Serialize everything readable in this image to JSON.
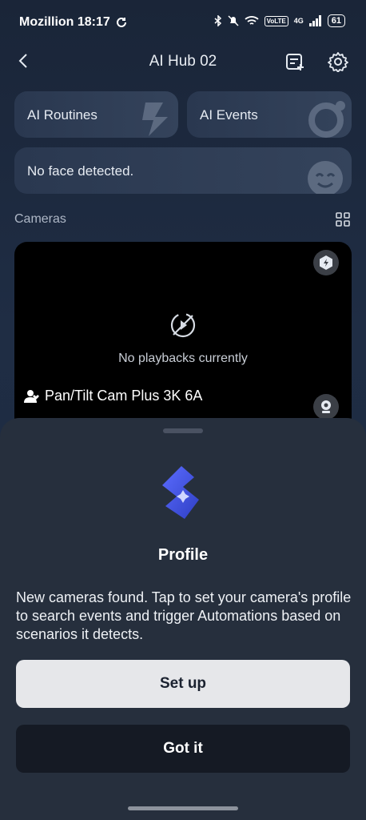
{
  "status_bar": {
    "carrier_time": "Mozillion 18:17",
    "volte": "VoLTE",
    "network": "4G",
    "battery": "61"
  },
  "header": {
    "title": "AI Hub 02"
  },
  "cards": {
    "ai_routines": "AI Routines",
    "ai_events": "AI Events",
    "face_status": "No face detected."
  },
  "cameras": {
    "section_label": "Cameras",
    "playback_status": "No playbacks currently",
    "camera_name": "Pan/Tilt Cam Plus 3K 6A"
  },
  "sheet": {
    "title": "Profile",
    "description": "New cameras found. Tap to set your camera's profile to search events and trigger Automations based on scenarios it detects.",
    "setup_label": "Set up",
    "gotit_label": "Got it"
  },
  "colors": {
    "background": "#1f2d42",
    "sheet": "#262f3d",
    "accent_logo": "#3b4fd8"
  }
}
